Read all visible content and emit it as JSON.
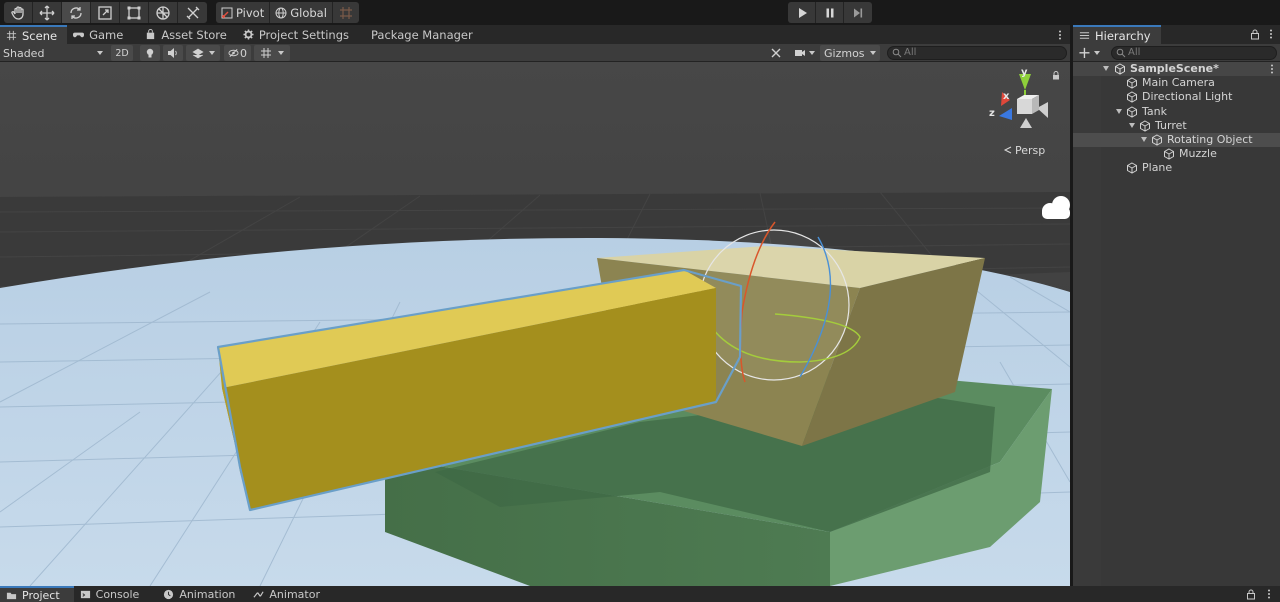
{
  "toolbar": {
    "tools": [
      "hand-tool",
      "move-tool",
      "rotate-tool",
      "scale-tool",
      "rect-tool",
      "transform-tool",
      "custom-tool"
    ],
    "active_tool": "rotate-tool",
    "pivot_label": "Pivot",
    "global_label": "Global"
  },
  "scene_tabs": [
    {
      "label": "Scene",
      "icon": "grid-icon",
      "active": true
    },
    {
      "label": "Game",
      "icon": "gamepad-icon"
    },
    {
      "label": "Asset Store",
      "icon": "bag-icon"
    },
    {
      "label": "Project Settings",
      "icon": "gear-icon"
    },
    {
      "label": "Package Manager",
      "icon": ""
    }
  ],
  "scene_toolbar": {
    "shading_mode": "Shaded",
    "mode_2d": "2D",
    "hidden_count": "0",
    "gizmos_label": "Gizmos",
    "search_placeholder": "All"
  },
  "gizmo": {
    "x_label": "x",
    "y_label": "y",
    "z_label": "z",
    "projection_label": "Persp",
    "x_color": "#e0483a",
    "y_color": "#8ecf3a",
    "z_color": "#3a78e0"
  },
  "hierarchy": {
    "tab_label": "Hierarchy",
    "search_placeholder": "All",
    "add_label": "+",
    "items": [
      {
        "label": "SampleScene*",
        "depth": 0,
        "expanded": true,
        "scene": true
      },
      {
        "label": "Main Camera",
        "depth": 1
      },
      {
        "label": "Directional Light",
        "depth": 1
      },
      {
        "label": "Tank",
        "depth": 1,
        "expanded": true
      },
      {
        "label": "Turret",
        "depth": 2,
        "expanded": true
      },
      {
        "label": "Rotating Object",
        "depth": 3,
        "expanded": true,
        "selected": true
      },
      {
        "label": "Muzzle",
        "depth": 4
      },
      {
        "label": "Plane",
        "depth": 1
      }
    ]
  },
  "bottom_tabs": [
    {
      "label": "Project",
      "icon": "folder-icon",
      "active": true
    },
    {
      "label": "Console",
      "icon": "console-icon"
    },
    {
      "label": "Animation",
      "icon": "clock-icon"
    },
    {
      "label": "Animator",
      "icon": "animator-icon"
    }
  ],
  "colors": {
    "selection_outline": "#6a9fc8",
    "barrel": "#c3ad30",
    "turret": "#9b915a",
    "hull": "#5f8f63"
  }
}
